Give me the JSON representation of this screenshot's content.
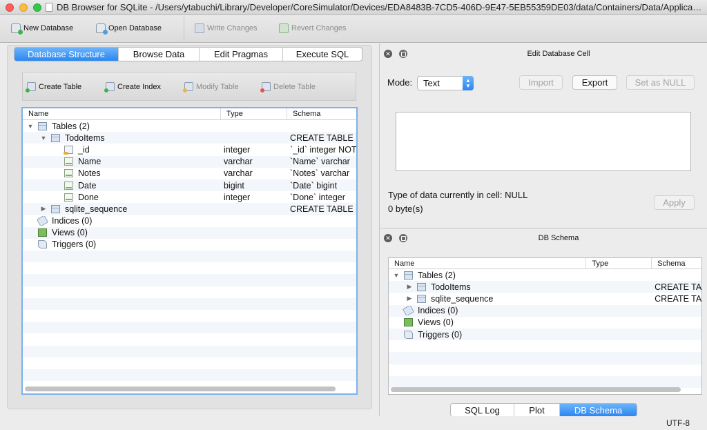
{
  "window": {
    "title": "DB Browser for SQLite - /Users/ytabuchi/Library/Developer/CoreSimulator/Devices/EDA8483B-7CD5-406D-9E47-5EB55359DE03/data/Containers/Data/Applicatio..."
  },
  "toolbar": {
    "new_database": "New Database",
    "open_database": "Open Database",
    "write_changes": "Write Changes",
    "revert_changes": "Revert Changes"
  },
  "main_tabs": [
    {
      "label": "Database Structure",
      "active": true
    },
    {
      "label": "Browse Data",
      "active": false
    },
    {
      "label": "Edit Pragmas",
      "active": false
    },
    {
      "label": "Execute SQL",
      "active": false
    }
  ],
  "structure_toolbar": {
    "create_table": "Create Table",
    "create_index": "Create Index",
    "modify_table": "Modify Table",
    "delete_table": "Delete Table"
  },
  "structure_tree": {
    "columns": [
      "Name",
      "Type",
      "Schema"
    ],
    "rows": [
      {
        "name": "Tables (2)",
        "type": "",
        "schema": "",
        "icon": "table-icon",
        "disclosure": "▼",
        "depth": 0
      },
      {
        "name": "TodoItems",
        "type": "",
        "schema": "CREATE TABLE",
        "icon": "table-icon",
        "disclosure": "▼",
        "depth": 1
      },
      {
        "name": "_id",
        "type": "integer",
        "schema": "`_id` integer NOT",
        "icon": "key-field-icon",
        "disclosure": "",
        "depth": 2
      },
      {
        "name": "Name",
        "type": "varchar",
        "schema": "`Name` varchar",
        "icon": "field-icon",
        "disclosure": "",
        "depth": 2
      },
      {
        "name": "Notes",
        "type": "varchar",
        "schema": "`Notes` varchar",
        "icon": "field-icon",
        "disclosure": "",
        "depth": 2
      },
      {
        "name": "Date",
        "type": "bigint",
        "schema": "`Date` bigint",
        "icon": "field-icon",
        "disclosure": "",
        "depth": 2
      },
      {
        "name": "Done",
        "type": "integer",
        "schema": "`Done` integer",
        "icon": "field-icon",
        "disclosure": "",
        "depth": 2
      },
      {
        "name": "sqlite_sequence",
        "type": "",
        "schema": "CREATE TABLE",
        "icon": "table-icon",
        "disclosure": "▶",
        "depth": 1
      },
      {
        "name": "Indices (0)",
        "type": "",
        "schema": "",
        "icon": "index-icon",
        "disclosure": "",
        "depth": 0
      },
      {
        "name": "Views (0)",
        "type": "",
        "schema": "",
        "icon": "view-icon",
        "disclosure": "",
        "depth": 0
      },
      {
        "name": "Triggers (0)",
        "type": "",
        "schema": "",
        "icon": "trigger-icon",
        "disclosure": "",
        "depth": 0
      }
    ]
  },
  "edit_cell": {
    "title": "Edit Database Cell",
    "mode_label": "Mode:",
    "mode_value": "Text",
    "import": "Import",
    "export": "Export",
    "set_null": "Set as NULL",
    "type_info": "Type of data currently in cell: NULL",
    "size_info": "0 byte(s)",
    "apply": "Apply"
  },
  "db_schema": {
    "title": "DB Schema",
    "columns": [
      "Name",
      "Type",
      "Schema"
    ],
    "rows": [
      {
        "name": "Tables (2)",
        "type": "",
        "schema": "",
        "icon": "table-icon",
        "disclosure": "▼",
        "depth": 0
      },
      {
        "name": "TodoItems",
        "type": "",
        "schema": "CREATE TA",
        "icon": "table-icon",
        "disclosure": "▶",
        "depth": 1
      },
      {
        "name": "sqlite_sequence",
        "type": "",
        "schema": "CREATE TA",
        "icon": "table-icon",
        "disclosure": "▶",
        "depth": 1
      },
      {
        "name": "Indices (0)",
        "type": "",
        "schema": "",
        "icon": "index-icon",
        "disclosure": "",
        "depth": 0
      },
      {
        "name": "Views (0)",
        "type": "",
        "schema": "",
        "icon": "view-icon",
        "disclosure": "",
        "depth": 0
      },
      {
        "name": "Triggers (0)",
        "type": "",
        "schema": "",
        "icon": "trigger-icon",
        "disclosure": "",
        "depth": 0
      }
    ]
  },
  "bottom_tabs": [
    {
      "label": "SQL Log",
      "active": false
    },
    {
      "label": "Plot",
      "active": false
    },
    {
      "label": "DB Schema",
      "active": true
    }
  ],
  "status": {
    "encoding": "UTF-8"
  },
  "colors": {
    "accent": "#2a87f1",
    "selection_border": "#7fb0ec"
  }
}
